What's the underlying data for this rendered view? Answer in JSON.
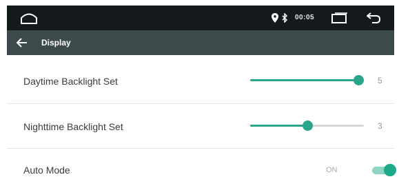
{
  "status_bar": {
    "time": "00:05",
    "icons": [
      "home-icon",
      "location-icon",
      "bluetooth-icon",
      "recent-apps-icon",
      "back-icon"
    ]
  },
  "app_bar": {
    "title": "Display",
    "back_icon": "arrow-left-icon"
  },
  "settings": [
    {
      "label": "Daytime Backlight Set",
      "value": "5",
      "level": 1.0
    },
    {
      "label": "Nighttime Backlight Set",
      "value": "3",
      "level": 0.5
    },
    {
      "label": "Auto Mode",
      "state": "ON",
      "enabled": true
    }
  ],
  "colors": {
    "accent": "#2aa48a",
    "status_bar_bg": "#141a1c",
    "app_bar_bg": "#3d4a4b",
    "track": "#d6d6d6"
  }
}
